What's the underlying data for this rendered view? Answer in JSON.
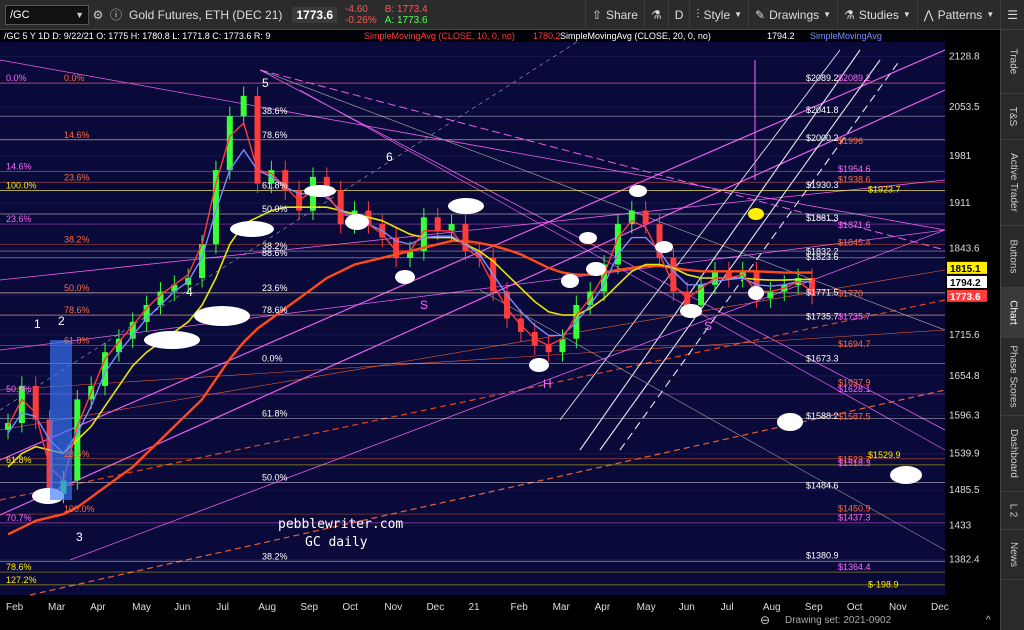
{
  "toolbar": {
    "symbol": "/GC",
    "name": "Gold Futures, ETH (DEC 21)",
    "last": "1773.6",
    "change": "-4.60",
    "change_pct": "-0.26%",
    "bid": "B: 1773.4",
    "ask": "A: 1773.6",
    "share": "Share",
    "period": "D",
    "style": "Style",
    "drawings": "Drawings",
    "studies": "Studies",
    "patterns": "Patterns"
  },
  "header": {
    "info": "/GC 5 Y 1D   D: 9/22/21   O: 1775   H: 1780.8   L: 1771.8   C: 1773.6   R: 9",
    "sma1": "SimpleMovingAvg (CLOSE, 10, 0, no)",
    "sma1_val": "1780.2",
    "sma2": "SimpleMovingAvg (CLOSE, 20, 0, no)",
    "sma2_val": "1794.2",
    "sma3": "SimpleMovingAvg"
  },
  "footer": {
    "drawing_set": "Drawing set: 2021-0902"
  },
  "right_tabs": [
    "Trade",
    "T&S",
    "Active Trader",
    "Buttons",
    "Chart",
    "Phase Scores",
    "Dashboard",
    "L 2",
    "News"
  ],
  "watermark": [
    "pebblewriter.com",
    "GC daily"
  ],
  "colors": {
    "background": "#0a0a3a",
    "candle_up": "#39ff39",
    "candle_down": "#ff3b3b",
    "sma10": "#ff3b3b",
    "sma20": "#7b8cff",
    "sma50": "#e6e600",
    "sma200": "#ff4a1a",
    "fib": "#ff66ff"
  },
  "chart_data": {
    "type": "candlestick",
    "symbol": "/GC",
    "ylim": [
      1330,
      2150
    ],
    "y_ticks": [
      2128.8,
      2053.5,
      1981,
      1911,
      1843.6,
      1774.4,
      1715.6,
      1654.8,
      1596.3,
      1539.9,
      1485.5,
      1433,
      1382.4
    ],
    "x_ticks": [
      "Feb",
      "Mar",
      "Apr",
      "May",
      "Jun",
      "Jul",
      "Aug",
      "Sep",
      "Oct",
      "Nov",
      "Dec",
      "21",
      "Feb",
      "Mar",
      "Apr",
      "May",
      "Jun",
      "Jul",
      "Aug",
      "Sep",
      "Oct",
      "Nov",
      "Dec"
    ],
    "last_price": 1773.6,
    "price_flags": [
      {
        "value": 1815.1,
        "bg": "#ffee00",
        "fg": "#000"
      },
      {
        "value": 1794.2,
        "bg": "#ffffff",
        "fg": "#000"
      },
      {
        "value": 1773.6,
        "bg": "#ff3b3b",
        "fg": "#fff"
      }
    ],
    "closes": [
      1585,
      1640,
      1590,
      1480,
      1500,
      1620,
      1640,
      1690,
      1710,
      1735,
      1760,
      1780,
      1790,
      1800,
      1850,
      1960,
      2040,
      2070,
      1940,
      1960,
      1930,
      1900,
      1950,
      1930,
      1880,
      1900,
      1880,
      1860,
      1830,
      1840,
      1890,
      1870,
      1880,
      1840,
      1830,
      1780,
      1740,
      1720,
      1700,
      1690,
      1710,
      1760,
      1780,
      1820,
      1880,
      1900,
      1880,
      1830,
      1780,
      1760,
      1790,
      1810,
      1800,
      1810,
      1770,
      1780,
      1790,
      1800,
      1775
    ],
    "sma10": [
      1580,
      1620,
      1600,
      1520,
      1500,
      1580,
      1630,
      1680,
      1705,
      1730,
      1755,
      1775,
      1790,
      1805,
      1850,
      1940,
      2010,
      2030,
      1960,
      1955,
      1935,
      1915,
      1930,
      1925,
      1895,
      1890,
      1880,
      1865,
      1840,
      1840,
      1870,
      1870,
      1870,
      1845,
      1830,
      1790,
      1755,
      1730,
      1710,
      1700,
      1710,
      1745,
      1770,
      1805,
      1860,
      1885,
      1875,
      1835,
      1790,
      1770,
      1785,
      1800,
      1800,
      1805,
      1780,
      1780,
      1785,
      1795,
      1780
    ],
    "sma20": [
      1570,
      1600,
      1595,
      1560,
      1540,
      1570,
      1610,
      1660,
      1690,
      1715,
      1740,
      1760,
      1780,
      1795,
      1830,
      1900,
      1960,
      1990,
      1960,
      1950,
      1935,
      1925,
      1925,
      1920,
      1900,
      1890,
      1880,
      1870,
      1855,
      1850,
      1860,
      1862,
      1862,
      1850,
      1835,
      1805,
      1775,
      1750,
      1730,
      1715,
      1715,
      1735,
      1760,
      1790,
      1835,
      1860,
      1860,
      1840,
      1810,
      1790,
      1790,
      1795,
      1798,
      1800,
      1790,
      1788,
      1790,
      1795,
      1794
    ],
    "sma50": [
      1520,
      1540,
      1550,
      1545,
      1540,
      1560,
      1580,
      1610,
      1640,
      1670,
      1690,
      1705,
      1720,
      1735,
      1760,
      1800,
      1850,
      1880,
      1890,
      1900,
      1905,
      1905,
      1905,
      1905,
      1900,
      1895,
      1890,
      1885,
      1875,
      1865,
      1860,
      1860,
      1860,
      1850,
      1840,
      1825,
      1805,
      1785,
      1765,
      1750,
      1745,
      1745,
      1755,
      1770,
      1790,
      1810,
      1820,
      1820,
      1815,
      1805,
      1800,
      1800,
      1800,
      1800,
      1798,
      1797,
      1797,
      1798,
      1798
    ],
    "sma200": [
      1420,
      1430,
      1440,
      1445,
      1450,
      1460,
      1475,
      1490,
      1505,
      1520,
      1540,
      1560,
      1580,
      1600,
      1620,
      1650,
      1680,
      1705,
      1725,
      1740,
      1755,
      1770,
      1785,
      1800,
      1810,
      1820,
      1825,
      1830,
      1835,
      1840,
      1845,
      1850,
      1855,
      1855,
      1852,
      1848,
      1842,
      1835,
      1825,
      1815,
      1808,
      1805,
      1805,
      1808,
      1812,
      1815,
      1818,
      1818,
      1815,
      1812,
      1810,
      1810,
      1810,
      1810,
      1810,
      1809,
      1808,
      1808,
      1808
    ],
    "levels_left": [
      {
        "value": 2089,
        "label": "0.0%",
        "color": "#ff66ff"
      },
      {
        "value": 2089,
        "label": "0.0%",
        "color": "#ff6a3a"
      },
      {
        "value": 2040,
        "label": "38.6%",
        "color": "#ffffff"
      },
      {
        "value": 2005,
        "label": "78.6%",
        "color": "#ffffff"
      },
      {
        "value": 2005,
        "label": "14.6%",
        "color": "#ff6a3a"
      },
      {
        "value": 1958,
        "label": "14.6%",
        "color": "#ff66ff"
      },
      {
        "value": 1942,
        "label": "23.6%",
        "color": "#ff6a3a"
      },
      {
        "value": 1930,
        "label": "61.8%",
        "color": "#ffffff"
      },
      {
        "value": 1930,
        "label": "100.0%",
        "color": "#ffee00"
      },
      {
        "value": 1895,
        "label": "50.0%",
        "color": "#ffffff"
      },
      {
        "value": 1880,
        "label": "23.6%",
        "color": "#ff66ff"
      },
      {
        "value": 1850,
        "label": "38.2%",
        "color": "#ff6a3a"
      },
      {
        "value": 1840,
        "label": "38.2%",
        "color": "#ffffff"
      },
      {
        "value": 1830,
        "label": "88.6%",
        "color": "#ffffff"
      },
      {
        "value": 1778,
        "label": "50.0%",
        "color": "#ff6a3a"
      },
      {
        "value": 1778,
        "label": "23.6%",
        "color": "#ffffff"
      },
      {
        "value": 1745,
        "label": "78.6%",
        "color": "#ffffff"
      },
      {
        "value": 1745,
        "label": "78.6%",
        "color": "#ff6a3a"
      },
      {
        "value": 1700,
        "label": "61.8%",
        "color": "#ff6a3a"
      },
      {
        "value": 1673,
        "label": "0.0%",
        "color": "#ffffff"
      },
      {
        "value": 1628,
        "label": "50.0%",
        "color": "#ff66ff"
      },
      {
        "value": 1592,
        "label": "61.8%",
        "color": "#ffffff"
      },
      {
        "value": 1532,
        "label": "23.6%",
        "color": "#ff6a3a"
      },
      {
        "value": 1523,
        "label": "61.8%",
        "color": "#ffee00"
      },
      {
        "value": 1497,
        "label": "50.0%",
        "color": "#ffffff"
      },
      {
        "value": 1450,
        "label": "100.0%",
        "color": "#ff6a3a"
      },
      {
        "value": 1437,
        "label": "70.7%",
        "color": "#ff66ff"
      },
      {
        "value": 1380,
        "label": "38.2%",
        "color": "#ffffff"
      },
      {
        "value": 1364,
        "label": "78.6%",
        "color": "#ffee00"
      },
      {
        "value": 1345,
        "label": "127.2%",
        "color": "#ffee00"
      }
    ],
    "levels_right": [
      {
        "value": 2089.2,
        "label": "$2089.2",
        "color": "#ffffff"
      },
      {
        "value": 2089.2,
        "label": "$2089.2",
        "color": "#ff66ff"
      },
      {
        "value": 2041.8,
        "label": "$2041.8",
        "color": "#ffffff"
      },
      {
        "value": 2000.2,
        "label": "$2000.2",
        "color": "#ffffff"
      },
      {
        "value": 1996,
        "label": "$1996",
        "color": "#ff6a3a"
      },
      {
        "value": 1954.6,
        "label": "$1954.6",
        "color": "#ff66ff"
      },
      {
        "value": 1938.6,
        "label": "$1938.6",
        "color": "#ff6a3a"
      },
      {
        "value": 1930.3,
        "label": "$1930.3",
        "color": "#ffffff"
      },
      {
        "value": 1923.7,
        "label": "$1923.7",
        "color": "#ffee00"
      },
      {
        "value": 1881.3,
        "label": "$1881.3",
        "color": "#ffffff"
      },
      {
        "value": 1871.6,
        "label": "$1871.6",
        "color": "#ff66ff"
      },
      {
        "value": 1845.4,
        "label": "$1845.4",
        "color": "#ff6a3a"
      },
      {
        "value": 1832.2,
        "label": "$1832.2",
        "color": "#ffffff"
      },
      {
        "value": 1823.6,
        "label": "$1823.6",
        "color": "#ffffff"
      },
      {
        "value": 1771.5,
        "label": "$1771.5",
        "color": "#ffffff"
      },
      {
        "value": 1770,
        "label": "$1770",
        "color": "#ff6a3a"
      },
      {
        "value": 1735.7,
        "label": "$1735.7",
        "color": "#ffffff"
      },
      {
        "value": 1735.7,
        "label": "$1735.7",
        "color": "#ff66ff"
      },
      {
        "value": 1694.7,
        "label": "$1694.7",
        "color": "#ff6a3a"
      },
      {
        "value": 1673.3,
        "label": "$1673.3",
        "color": "#ffffff"
      },
      {
        "value": 1637.9,
        "label": "$1637.9",
        "color": "#ff6a3a"
      },
      {
        "value": 1628.1,
        "label": "$1628.1",
        "color": "#ff66ff"
      },
      {
        "value": 1588.2,
        "label": "$1588.2",
        "color": "#ffffff"
      },
      {
        "value": 1587.5,
        "label": "$1587.5",
        "color": "#ff6a3a"
      },
      {
        "value": 1529.9,
        "label": "$1529.9",
        "color": "#ffee00"
      },
      {
        "value": 1523.7,
        "label": "$1523.7",
        "color": "#ff6a3a"
      },
      {
        "value": 1518.3,
        "label": "$1518.3",
        "color": "#ff66ff"
      },
      {
        "value": 1484.6,
        "label": "$1484.6",
        "color": "#ffffff"
      },
      {
        "value": 1450.9,
        "label": "$1450.9",
        "color": "#ff6a3a"
      },
      {
        "value": 1437.3,
        "label": "$1437.3",
        "color": "#ff66ff"
      },
      {
        "value": 1380.9,
        "label": "$1380.9",
        "color": "#ffffff"
      },
      {
        "value": 1364.4,
        "label": "$1364.4",
        "color": "#ff66ff"
      },
      {
        "value": -198.9,
        "label": "$-198.9",
        "color": "#ffee00"
      }
    ],
    "annotations": [
      "1",
      "2",
      "3",
      "4",
      "5",
      "6",
      "S",
      "S",
      "H"
    ]
  }
}
